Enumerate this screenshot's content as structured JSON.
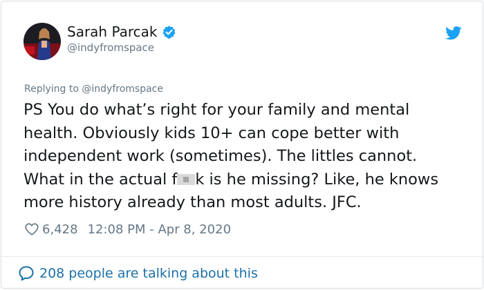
{
  "author": {
    "display_name": "Sarah Parcak",
    "handle": "@indyfromspace",
    "verified_icon": "verified-badge-icon",
    "avatar_icon": "avatar"
  },
  "reply": {
    "prefix": "Replying to",
    "mention": "@indyfromspace"
  },
  "tweet": {
    "text_before_redaction": "PS You do what’s right for your family and mental health. Obviously kids 10+ can cope better with independent work (sometimes). The littles cannot. What in the actual f",
    "text_after_redaction": "k is he missing? Like, he knows more history already than most adults. JFC."
  },
  "meta": {
    "like_count": "6,428",
    "timestamp": "12:08 PM - Apr 8, 2020"
  },
  "footer": {
    "talking_label": "208 people are talking about this"
  },
  "colors": {
    "brand_blue": "#1da1f2",
    "link_blue": "#1b6fa6",
    "secondary_text": "#657786",
    "primary_text": "#14171a"
  }
}
